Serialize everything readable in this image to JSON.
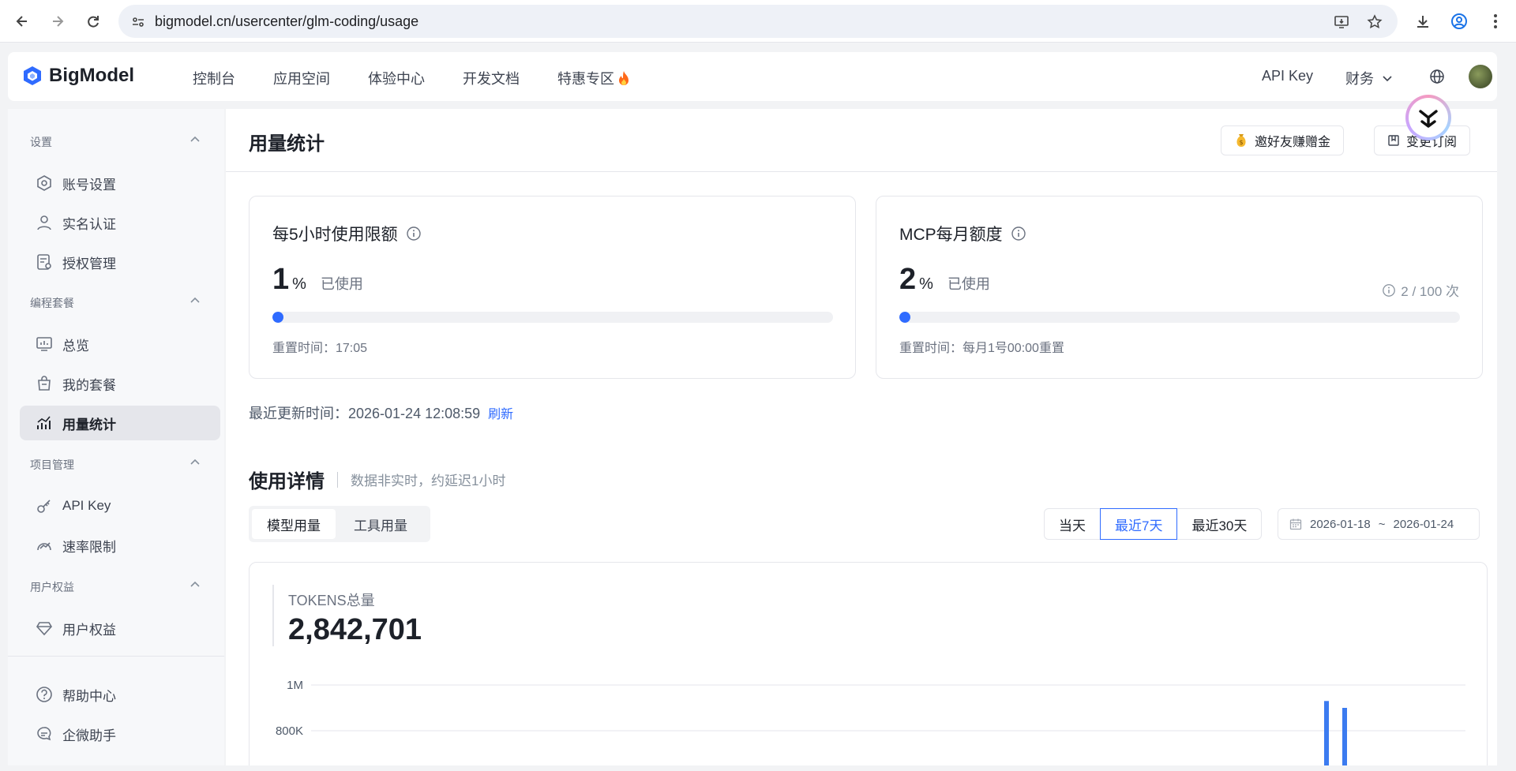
{
  "browser": {
    "url": "bigmodel.cn/usercenter/glm-coding/usage"
  },
  "topnav": {
    "logo": "BigModel",
    "items": [
      "控制台",
      "应用空间",
      "体验中心",
      "开发文档",
      "特惠专区"
    ],
    "api_key": "API Key",
    "finance": "财务"
  },
  "sidebar": {
    "groups": [
      {
        "label": "设置",
        "items": [
          "账号设置",
          "实名认证",
          "授权管理"
        ]
      },
      {
        "label": "编程套餐",
        "items": [
          "总览",
          "我的套餐",
          "用量统计"
        ]
      },
      {
        "label": "项目管理",
        "items": [
          "API Key",
          "速率限制"
        ]
      },
      {
        "label": "用户权益",
        "items": [
          "用户权益"
        ]
      }
    ],
    "bottom": [
      "帮助中心",
      "企微助手"
    ],
    "active": "用量统计"
  },
  "header": {
    "title": "用量统计",
    "invite_button": "邀好友赚赠金",
    "change_sub_button": "变更订阅"
  },
  "cards": [
    {
      "title": "每5小时使用限额",
      "percent": "1",
      "unit": "%",
      "used_label": "已使用",
      "fill_percent": 1,
      "reset": "重置时间：17:05"
    },
    {
      "title": "MCP每月额度",
      "percent": "2",
      "unit": "%",
      "used_label": "已使用",
      "fill_percent": 2,
      "quota": "2 / 100 次",
      "reset": "重置时间：每月1号00:00重置"
    }
  ],
  "updated": {
    "label": "最近更新时间：2026-01-24 12:08:59",
    "refresh": "刷新"
  },
  "details": {
    "title": "使用详情",
    "subtitle": "数据非实时，约延迟1小时",
    "tabs": [
      "模型用量",
      "工具用量"
    ],
    "active_tab": "模型用量",
    "ranges": [
      "当天",
      "最近7天",
      "最近30天"
    ],
    "active_range": "最近7天",
    "date_from": "2026-01-18",
    "date_sep": "~",
    "date_to": "2026-01-24"
  },
  "tokens": {
    "label": "TOKENS总量",
    "value": "2,842,701"
  },
  "chart_data": {
    "type": "bar",
    "yticks": [
      "1M",
      "800K"
    ],
    "ylim": [
      0,
      1000000
    ],
    "values": [
      930000,
      900000
    ],
    "bar_color": "#3b7bf0",
    "grid": true
  },
  "colors": {
    "accent": "#2f6bff",
    "bar": "#3b7bf0"
  }
}
